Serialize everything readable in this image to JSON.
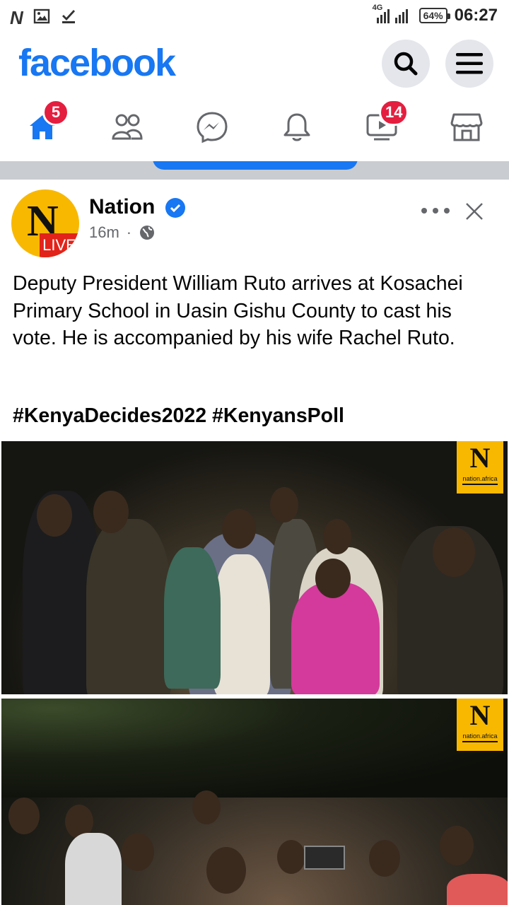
{
  "status_bar": {
    "left_icons": [
      "n-app-icon",
      "image-icon",
      "download-check-icon"
    ],
    "network": "4G",
    "battery": "64%",
    "time": "06:27"
  },
  "header": {
    "logo": "facebook",
    "search_icon": "search-icon",
    "menu_icon": "menu-icon"
  },
  "nav": {
    "items": [
      {
        "name": "home",
        "icon": "home-icon",
        "badge": "5",
        "active": true
      },
      {
        "name": "friends",
        "icon": "friends-icon",
        "badge": ""
      },
      {
        "name": "messenger",
        "icon": "messenger-icon",
        "badge": ""
      },
      {
        "name": "notifications",
        "icon": "bell-icon",
        "badge": ""
      },
      {
        "name": "watch",
        "icon": "video-icon",
        "badge": "14"
      },
      {
        "name": "marketplace",
        "icon": "store-icon",
        "badge": ""
      }
    ]
  },
  "post": {
    "author": "Nation",
    "avatar_letter": "N",
    "avatar_live": "LIVE",
    "time": "16m",
    "separator": "·",
    "privacy_icon": "globe-icon",
    "text": "Deputy President William Ruto arrives at Kosachei Primary School in Uasin Gishu County to cast his vote. He is accompanied by his wife Rachel Ruto.",
    "hashtags": "#KenyaDecides2022 #KenyansPoll",
    "watermark_letter": "N",
    "watermark_text": "nation.africa"
  },
  "colors": {
    "brand": "#1877f2",
    "badge": "#e41e3f",
    "nation_yellow": "#f8b800",
    "live_red": "#e2231a"
  }
}
